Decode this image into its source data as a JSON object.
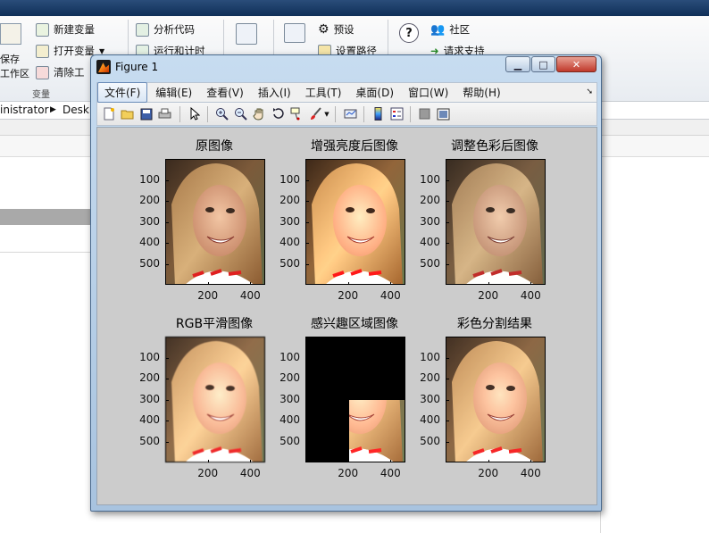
{
  "desktop": {
    "toolstrip": {
      "save_line1": "保存",
      "save_line2": "工作区",
      "new_variable": "新建变量",
      "open_variable": "打开变量",
      "clear_workspace": "清除工",
      "section_label": "变量",
      "analyze_code": "分析代码",
      "run_and_time": "运行和计时",
      "preferences": "预设",
      "set_path": "设置路径",
      "community": "社区",
      "request_support": "请求支持"
    },
    "address": {
      "seg1": "inistrator",
      "seg2": "Desk"
    }
  },
  "figure": {
    "title": "Figure 1",
    "window_buttons": {
      "minimize": "▁",
      "maximize": "□",
      "close": "✕"
    },
    "menu": [
      {
        "label": "文件(F)",
        "active": true
      },
      {
        "label": "编辑(E)"
      },
      {
        "label": "查看(V)"
      },
      {
        "label": "插入(I)"
      },
      {
        "label": "工具(T)"
      },
      {
        "label": "桌面(D)"
      },
      {
        "label": "窗口(W)"
      },
      {
        "label": "帮助(H)"
      }
    ],
    "toolbar_icons": [
      "new-figure-icon",
      "open-file-icon",
      "save-icon",
      "print-icon",
      "select-pointer-icon",
      "zoom-in-icon",
      "zoom-out-icon",
      "pan-hand-icon",
      "rotate-3d-icon",
      "data-cursor-icon",
      "brush-icon",
      "brush-dropdown-icon",
      "link-plot-icon",
      "colorbar-icon",
      "legend-icon",
      "hide-plot-tools-icon",
      "show-plot-tools-icon"
    ],
    "subplots": [
      {
        "title": "原图像",
        "variant": "original"
      },
      {
        "title": "增强亮度后图像",
        "variant": "bright"
      },
      {
        "title": "调整色彩后图像",
        "variant": "color"
      },
      {
        "title": "RGB平滑图像",
        "variant": "smooth"
      },
      {
        "title": "感兴趣区域图像",
        "variant": "roi"
      },
      {
        "title": "彩色分割结果",
        "variant": "segmented"
      }
    ],
    "yticks": [
      "100",
      "200",
      "300",
      "400",
      "500"
    ],
    "xticks": [
      "200",
      "400"
    ]
  }
}
